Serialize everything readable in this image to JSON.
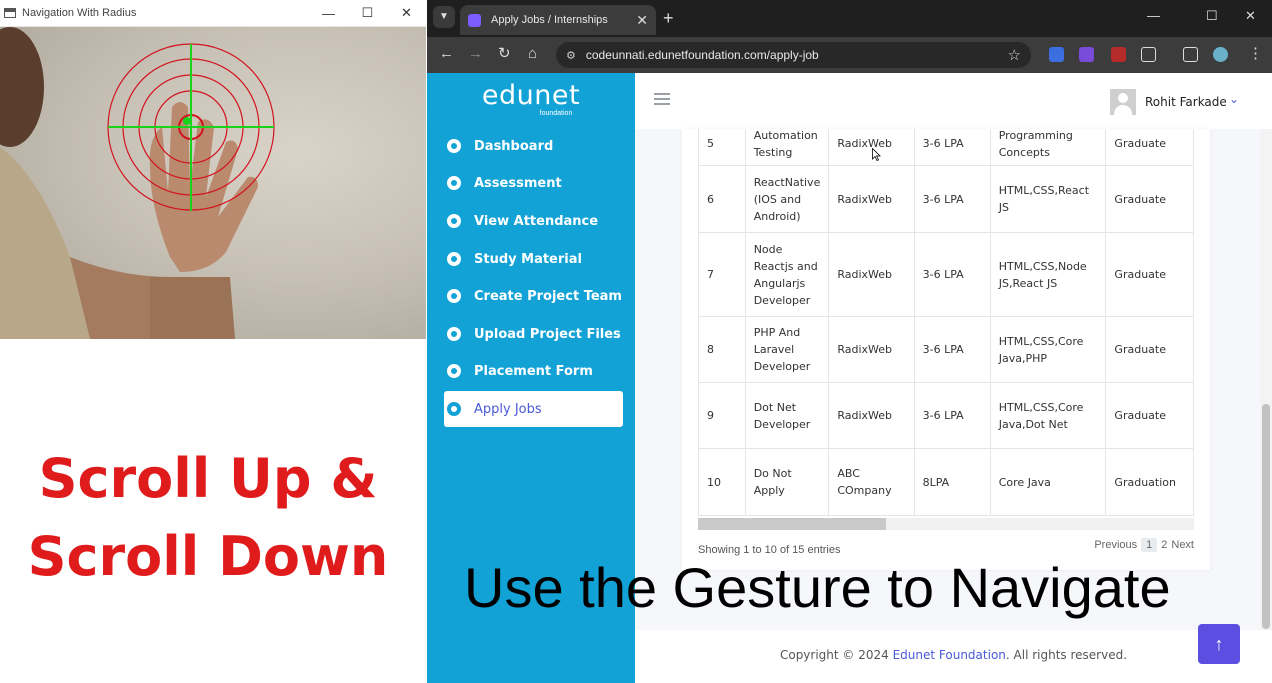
{
  "camera_window": {
    "title": "Navigation With Radius",
    "controls": {
      "minimize": "—",
      "maximize": "☐",
      "close": "✕"
    },
    "overlay_line1": "Scroll Up &",
    "overlay_line2": "Scroll Down",
    "overlay_color": "#e01b1b",
    "reticle_color": "#d2141e",
    "crosshair_color": "#19d219"
  },
  "browser": {
    "tab_title": "Apply Jobs / Internships",
    "tab_close": "✕",
    "new_tab": "+",
    "window_controls": {
      "minimize": "—",
      "maximize": "☐",
      "close": "✕"
    },
    "url": "codeunnati.edunetfoundation.com/apply-job",
    "nav": {
      "back": "←",
      "forward": "→",
      "reload": "↻",
      "home": "⌂"
    }
  },
  "sidebar": {
    "logo": "edunet",
    "logo_sub": "foundation",
    "items": [
      {
        "label": "Dashboard"
      },
      {
        "label": "Assessment"
      },
      {
        "label": "View Attendance"
      },
      {
        "label": "Study Material"
      },
      {
        "label": "Create Project Team"
      },
      {
        "label": "Upload Project Files"
      },
      {
        "label": "Placement Form"
      },
      {
        "label": "Apply Jobs",
        "active": true
      }
    ],
    "accent_color": "#13a2d6"
  },
  "topbar": {
    "user_name": "Rohit Farkade",
    "caret": "⌄"
  },
  "jobs_table": {
    "rows": [
      [
        "5",
        "Automation Testing",
        "RadixWeb",
        "3-6 LPA",
        "Programming Concepts",
        "Graduate"
      ],
      [
        "6",
        "ReactNative (IOS and Android)",
        "RadixWeb",
        "3-6 LPA",
        "HTML,CSS,React JS",
        "Graduate"
      ],
      [
        "7",
        "Node Reactjs and Angularjs Developer",
        "RadixWeb",
        "3-6 LPA",
        "HTML,CSS,Node JS,React JS",
        "Graduate"
      ],
      [
        "8",
        "PHP And Laravel Developer",
        "RadixWeb",
        "3-6 LPA",
        "HTML,CSS,Core Java,PHP",
        "Graduate"
      ],
      [
        "9",
        "Dot Net Developer",
        "RadixWeb",
        "3-6 LPA",
        "HTML,CSS,Core Java,Dot Net",
        "Graduate"
      ],
      [
        "10",
        "Do Not Apply",
        "ABC COmpany",
        "8LPA",
        "Core Java",
        "Graduation"
      ]
    ],
    "entries_info": "Showing 1 to 10 of 15 entries",
    "pager": {
      "previous": "Previous",
      "page1": "1",
      "page2": "2",
      "next": "Next"
    }
  },
  "footer": {
    "prefix": "Copyright © 2024 ",
    "link": "Edunet Foundation",
    "suffix": ". All rights reserved."
  },
  "back_to_top": "↑",
  "caption": "Use the Gesture to Navigate"
}
